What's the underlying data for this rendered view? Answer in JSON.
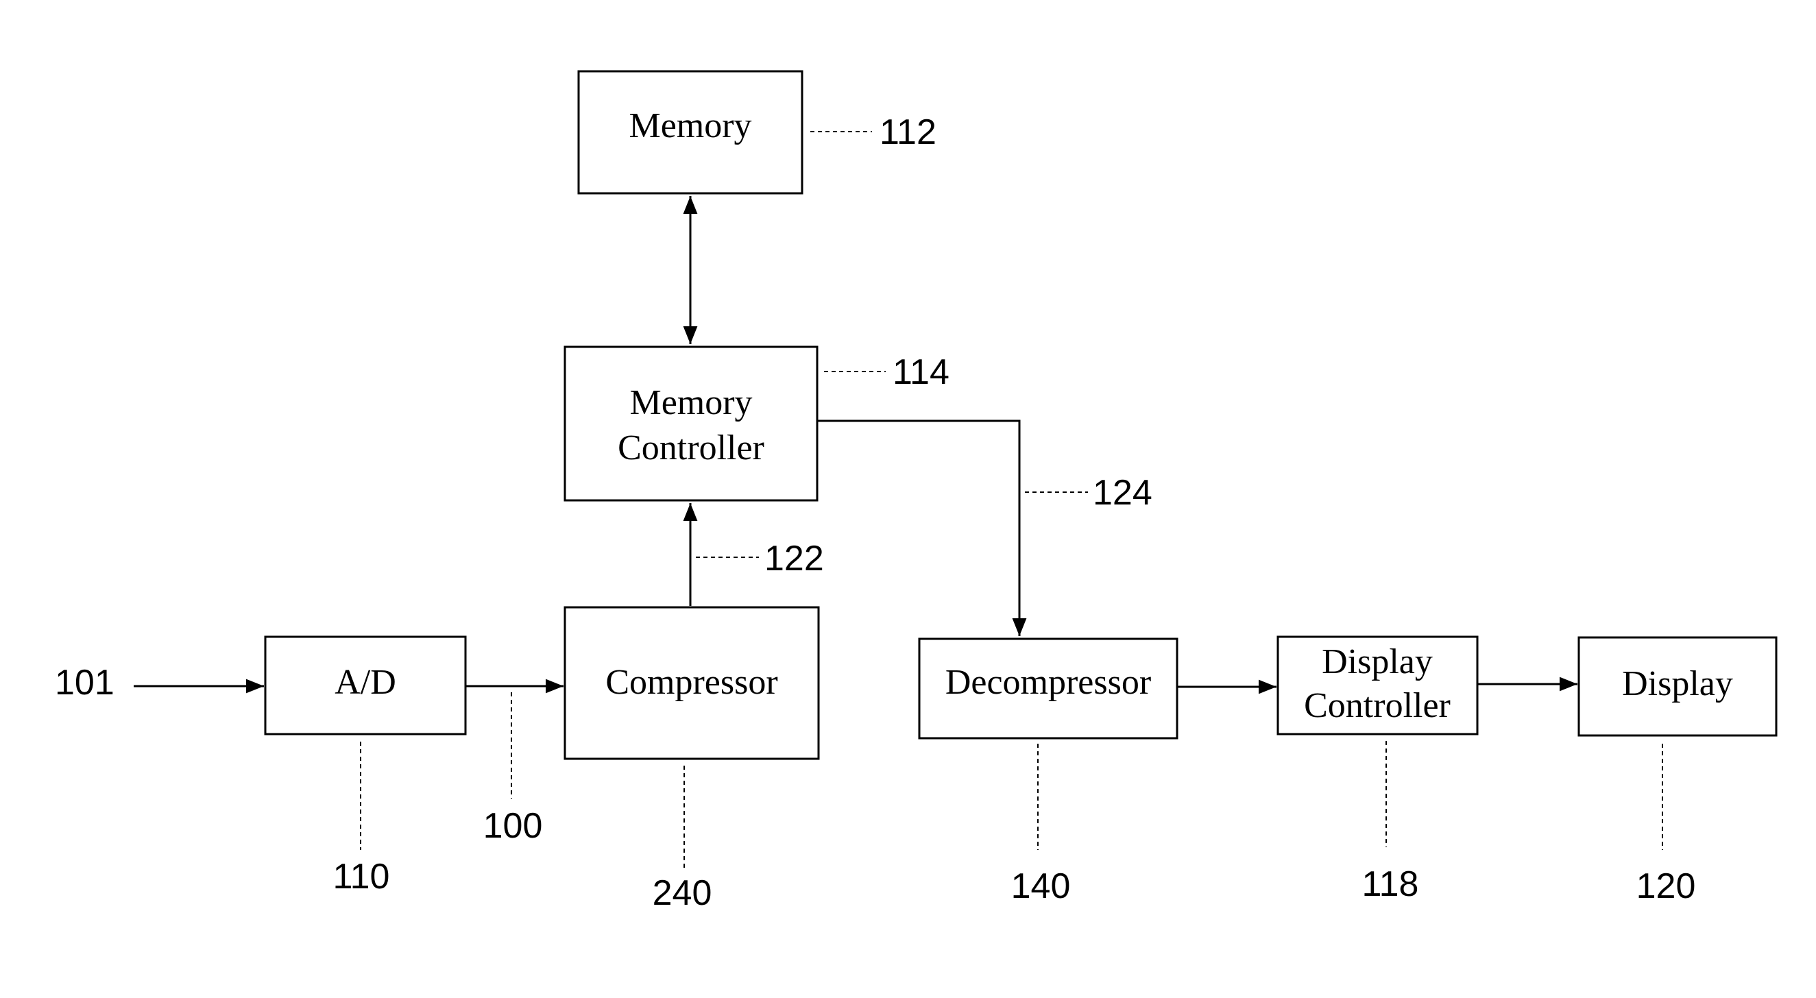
{
  "diagram": {
    "type": "block-diagram",
    "blocks": {
      "memory": {
        "lines": [
          "Memory"
        ],
        "ref": "112"
      },
      "memory_controller": {
        "lines": [
          "Memory",
          "Controller"
        ],
        "ref": "114"
      },
      "ad": {
        "lines": [
          "A/D"
        ],
        "ref": "110"
      },
      "compressor": {
        "lines": [
          "Compressor"
        ],
        "ref": "240"
      },
      "decompressor": {
        "lines": [
          "Decompressor"
        ],
        "ref": "140"
      },
      "display_controller": {
        "lines": [
          "Display",
          "Controller"
        ],
        "ref": "118"
      },
      "display": {
        "lines": [
          "Display"
        ],
        "ref": "120"
      }
    },
    "signals": {
      "input": "101",
      "ad_to_compressor": "100",
      "compressor_to_memctrl": "122",
      "memctrl_to_decompressor": "124"
    },
    "connections": [
      {
        "from": "input",
        "to": "ad",
        "arrow": "forward"
      },
      {
        "from": "ad",
        "to": "compressor",
        "arrow": "forward"
      },
      {
        "from": "compressor",
        "to": "memory_controller",
        "arrow": "forward"
      },
      {
        "from": "memory",
        "to": "memory_controller",
        "arrow": "both"
      },
      {
        "from": "memory_controller",
        "to": "decompressor",
        "arrow": "forward"
      },
      {
        "from": "decompressor",
        "to": "display_controller",
        "arrow": "forward"
      },
      {
        "from": "display_controller",
        "to": "display",
        "arrow": "forward"
      }
    ]
  }
}
